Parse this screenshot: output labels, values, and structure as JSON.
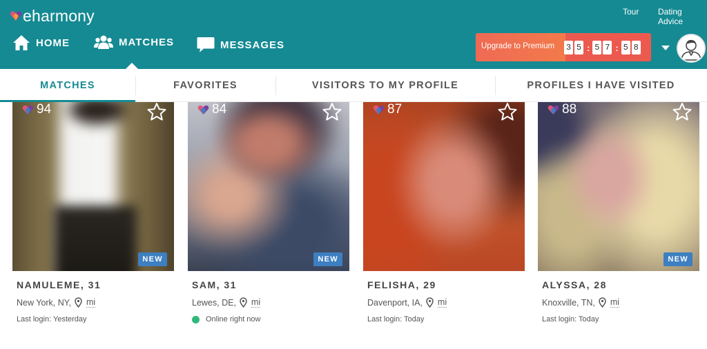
{
  "header": {
    "logo_text": "eharmony",
    "top_links": [
      "Tour",
      "Dating Advice"
    ],
    "nav": [
      {
        "label": "HOME",
        "icon": "home-icon"
      },
      {
        "label": "MATCHES",
        "icon": "users-icon"
      },
      {
        "label": "MESSAGES",
        "icon": "chat-bubble-icon"
      }
    ],
    "premium": {
      "label": "Upgrade to Premium",
      "timer_digits": [
        "3",
        "5",
        "5",
        "7",
        "5",
        "8"
      ]
    },
    "colors": {
      "primary": "#158a93",
      "premium": "#ec5a4f"
    }
  },
  "tabs": [
    {
      "label": "MATCHES",
      "active": true
    },
    {
      "label": "FAVORITES",
      "active": false
    },
    {
      "label": "VISITORS TO MY PROFILE",
      "active": false
    },
    {
      "label": "PROFILES I HAVE VISITED",
      "active": false
    }
  ],
  "matches": [
    {
      "score": "94",
      "name": "NAMULEME, 31",
      "location": "New York, NY,",
      "distance_unit": "mi",
      "new": "NEW",
      "status": "Last login: Yesterday",
      "online": false
    },
    {
      "score": "84",
      "name": "SAM, 31",
      "location": "Lewes, DE,",
      "distance_unit": "mi",
      "new": "NEW",
      "status": "Online right now",
      "online": true
    },
    {
      "score": "87",
      "name": "FELISHA, 29",
      "location": "Davenport, IA,",
      "distance_unit": "mi",
      "new": "",
      "status": "Last login: Today",
      "online": false
    },
    {
      "score": "88",
      "name": "ALYSSA, 28",
      "location": "Knoxville, TN,",
      "distance_unit": "mi",
      "new": "NEW",
      "status": "Last login: Today",
      "online": false
    }
  ]
}
